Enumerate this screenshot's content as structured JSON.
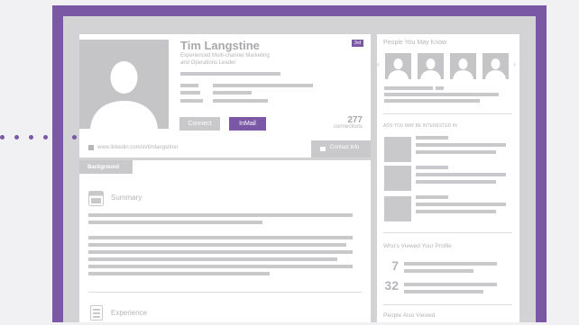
{
  "profile": {
    "name": "Tim Langstine",
    "headline_line1": "Experienced Multi-channel Marketing",
    "headline_line2": "and Operations Leader",
    "degree_badge": "3rd",
    "connect_label": "Connect",
    "inmail_label": "InMail",
    "connections_count": "277",
    "connections_label": "connections",
    "url": "www.linkedin.com/in/timlangstine/",
    "contact_info_label": "Contact Info"
  },
  "background": {
    "tab_label": "Background",
    "summary_title": "Summary",
    "experience_title": "Experience"
  },
  "sidebar": {
    "people_you_may_know_title": "People You May Know",
    "ads_title": "ADS YOU MAY BE INTERESTED IN",
    "who_viewed_title": "Who's Viewed Your Profile",
    "who_viewed_count": "7",
    "searches_count": "32",
    "people_also_viewed_title": "People Also Viewed"
  },
  "colors": {
    "accent": "#7b58a6",
    "placeholder": "#c9c9cc",
    "label": "#b5b5ba"
  }
}
